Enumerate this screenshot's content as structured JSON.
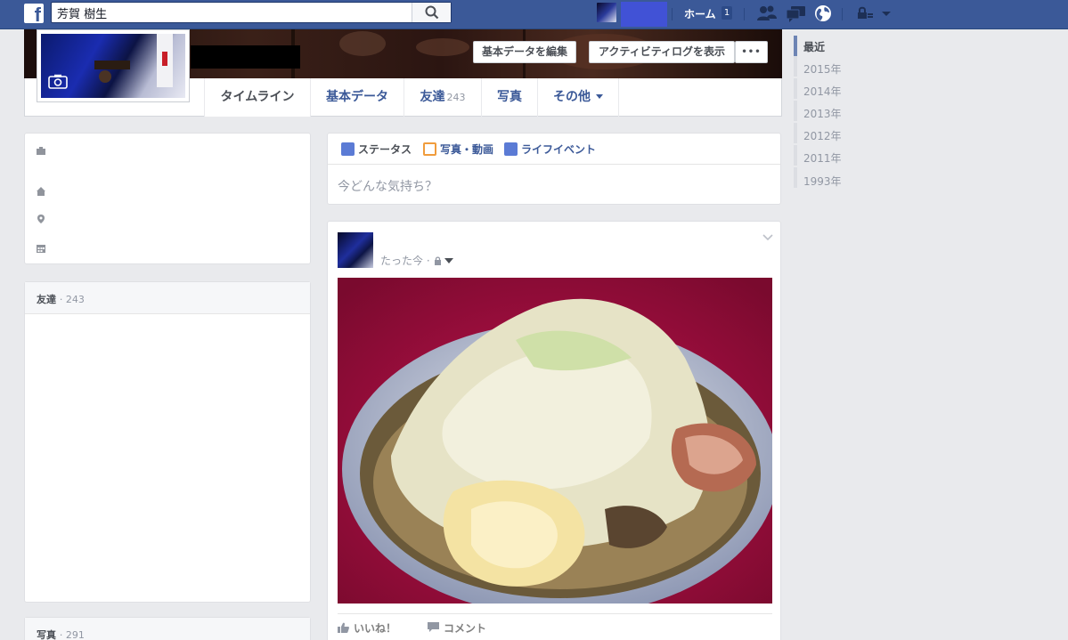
{
  "topbar": {
    "logo_letter": "f",
    "search_value": "芳賀 樹生",
    "home_label": "ホーム",
    "home_count": "1",
    "colors": {
      "bar": "#3b5998",
      "accent": "#4152d6"
    }
  },
  "profile": {
    "buttons": {
      "edit_info": "基本データを編集",
      "activity_log": "アクティビティログを表示",
      "more": "•••"
    },
    "tabs": [
      {
        "label": "タイムライン"
      },
      {
        "label": "基本データ"
      },
      {
        "label": "友達",
        "count": "243"
      },
      {
        "label": "写真"
      },
      {
        "label": "その他"
      }
    ]
  },
  "left": {
    "intro_icons": [
      "work-icon",
      "home-icon",
      "location-icon",
      "calendar-icon"
    ],
    "friends": {
      "label": "友達",
      "count": "243"
    },
    "photos": {
      "label": "写真",
      "count": "291"
    }
  },
  "composer": {
    "tab_status": "ステータス",
    "tab_photo": "写真・動画",
    "tab_life_event": "ライフイベント",
    "placeholder": "今どんな気持ち？"
  },
  "post": {
    "time": "たった今",
    "separator": "·",
    "photo_subject": "ramen-photo",
    "like_label": "いいね！",
    "comment_label": "コメント"
  },
  "timeline_nav": {
    "items": [
      "最近",
      "2015年",
      "2014年",
      "2013年",
      "2012年",
      "2011年",
      "1993年"
    ]
  }
}
